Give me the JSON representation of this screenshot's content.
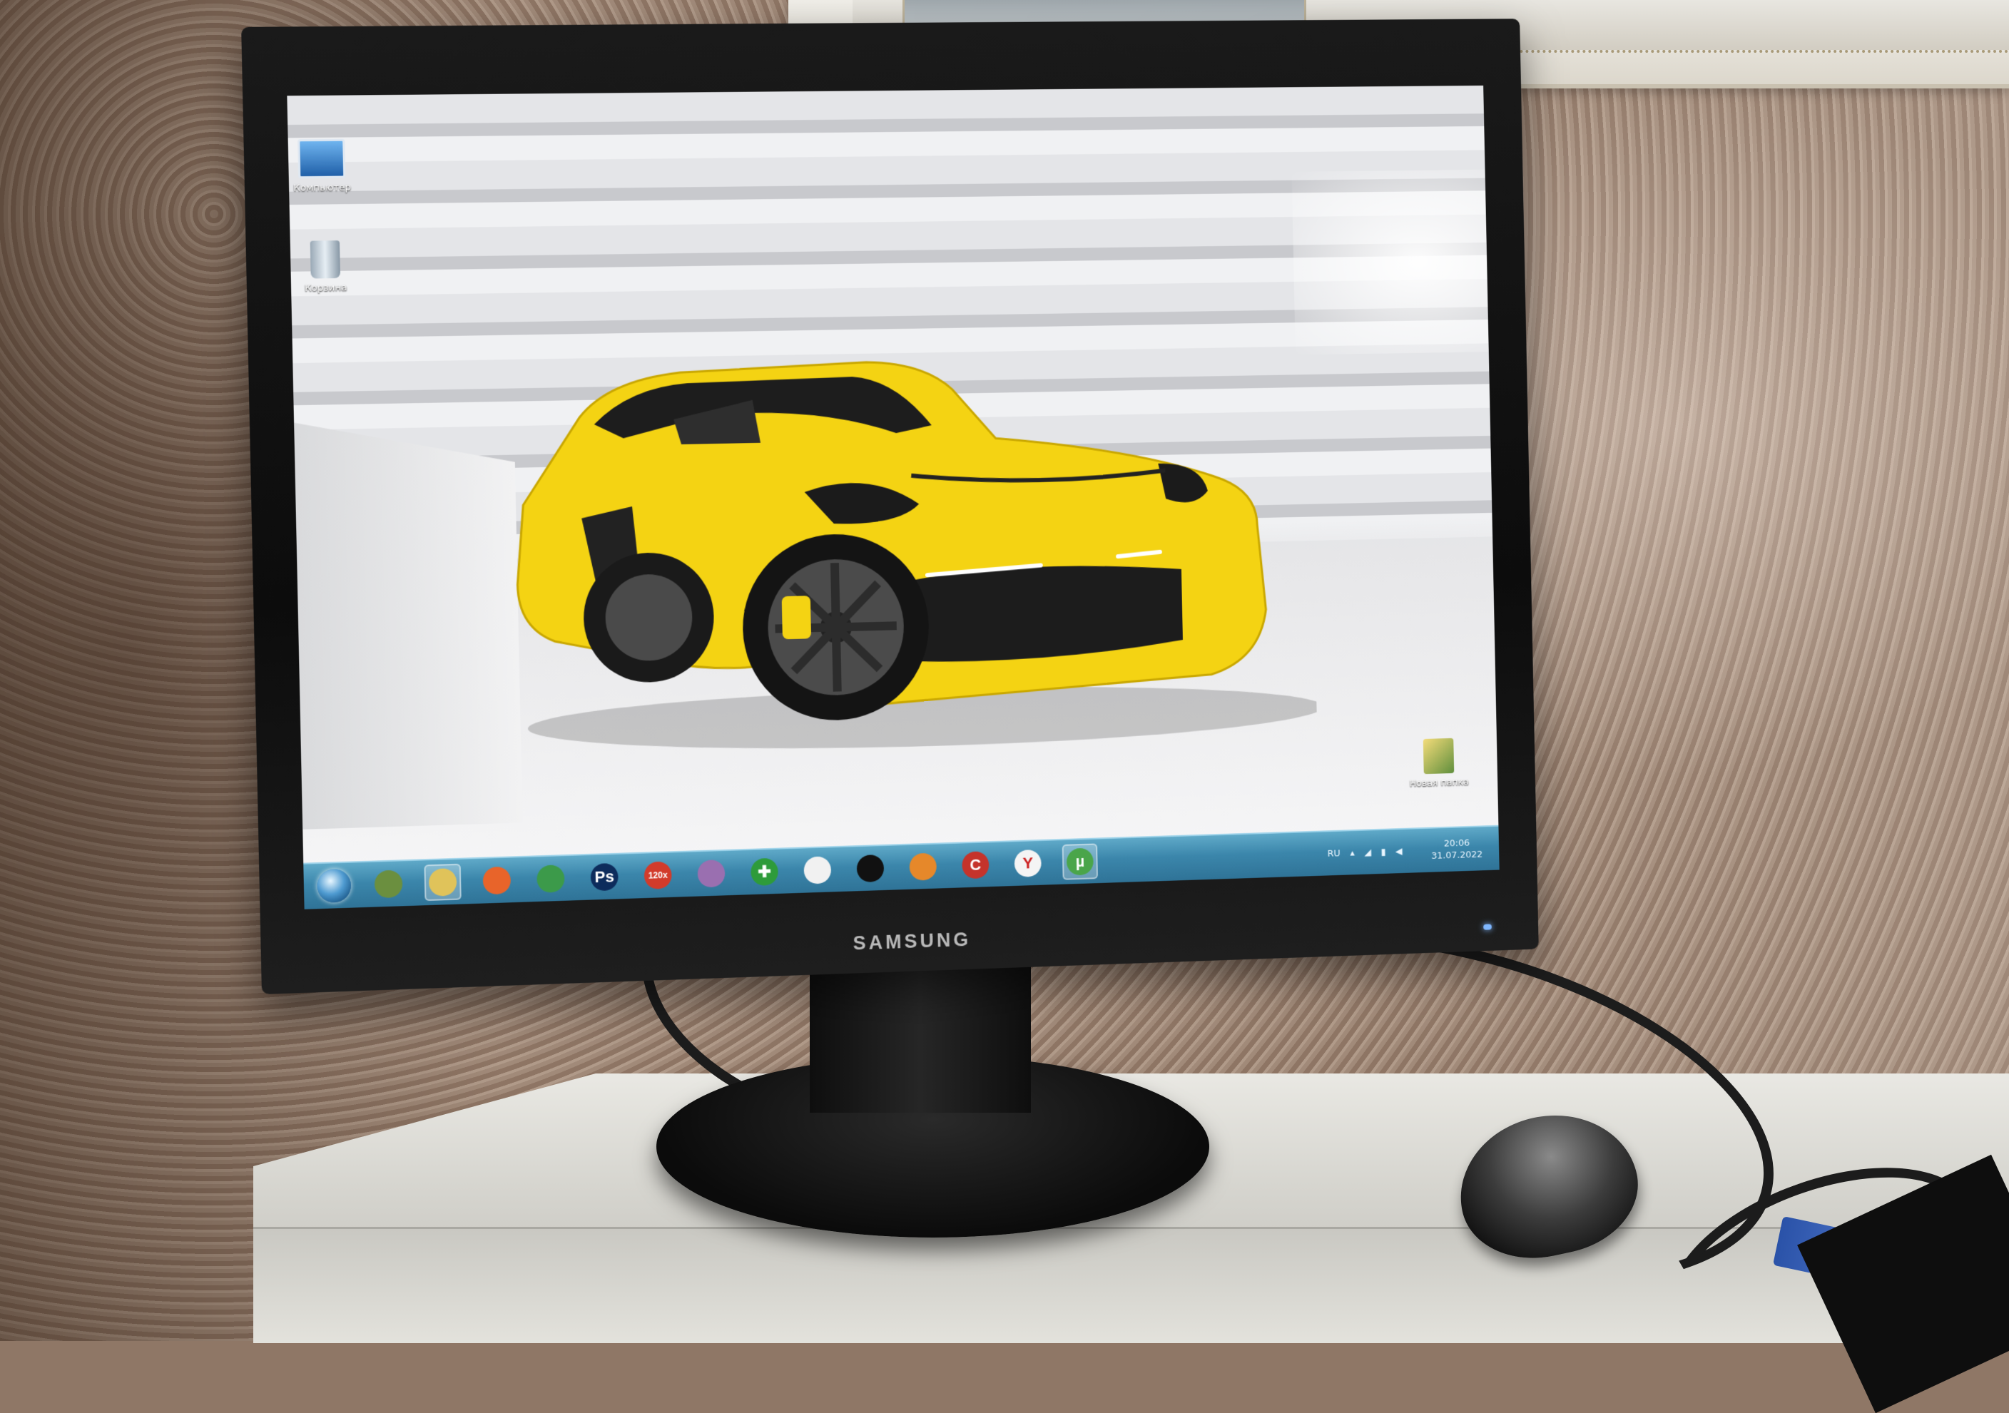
{
  "monitor": {
    "brand": "SAMSUNG"
  },
  "desktop": {
    "icons": [
      {
        "label": "Компьютер",
        "icon": "computer-icon"
      },
      {
        "label": "Корзина",
        "icon": "recycle-bin-icon"
      },
      {
        "label": "Новая папка",
        "icon": "folder-icon"
      }
    ],
    "wallpaper": "yellow sports car in white tunnel"
  },
  "taskbar": {
    "start": "windows-start-orb",
    "pinned": [
      {
        "name": "pen-tool-icon",
        "text": "",
        "color": "#6b8f3f"
      },
      {
        "name": "file-explorer-icon",
        "text": "",
        "color": "#e0c35a",
        "active": true
      },
      {
        "name": "firefox-icon",
        "text": "",
        "color": "#e8642a"
      },
      {
        "name": "chrome-icon",
        "text": "",
        "color": "#3c9a4a"
      },
      {
        "name": "photoshop-icon",
        "text": "Ps",
        "color": "#0d2c5c"
      },
      {
        "name": "acdsee-icon",
        "text": "120x",
        "color": "#d23b2b"
      },
      {
        "name": "dvd-icon",
        "text": "",
        "color": "#9a6fb0"
      },
      {
        "name": "green-cross-icon",
        "text": "✚",
        "color": "#2e9b3a"
      },
      {
        "name": "media-player-icon",
        "text": "",
        "color": "#f1f1f1"
      },
      {
        "name": "terminal-icon",
        "text": "",
        "color": "#111111"
      },
      {
        "name": "burning-icon",
        "text": "",
        "color": "#e6882a"
      },
      {
        "name": "ccleaner-icon",
        "text": "C",
        "color": "#c5332b"
      },
      {
        "name": "yandex-browser-icon",
        "text": "Y",
        "color": "#f4f4f4"
      },
      {
        "name": "utorrent-icon",
        "text": "µ",
        "color": "#4aa54a",
        "active": true
      }
    ],
    "tray": {
      "lang": "RU",
      "time": "20:06",
      "date": "31.07.2022"
    }
  }
}
